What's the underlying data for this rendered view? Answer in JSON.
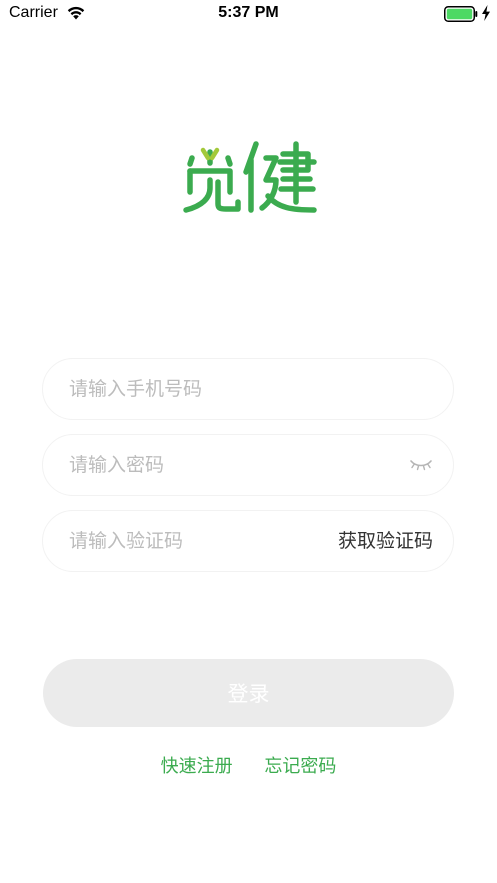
{
  "status_bar": {
    "carrier": "Carrier",
    "time": "5:37 PM",
    "wifi_icon": "wifi-icon",
    "battery_icon": "battery-icon",
    "charging_icon": "bolt-icon",
    "battery_color": "#4cd964"
  },
  "logo": {
    "text": "觅健",
    "color": "#3bab4f",
    "accent_color": "#a3c93a"
  },
  "form": {
    "phone_placeholder": "请输入手机号码",
    "phone_value": "",
    "password_placeholder": "请输入密码",
    "password_value": "",
    "password_toggle_icon": "eye-closed-icon",
    "code_placeholder": "请输入验证码",
    "code_value": "",
    "get_code_label": "获取验证码"
  },
  "login_button": {
    "label": "登录",
    "background": "#ebebeb"
  },
  "links": {
    "register": "快速注册",
    "forgot_password": "忘记密码",
    "color": "#3bab4f"
  }
}
